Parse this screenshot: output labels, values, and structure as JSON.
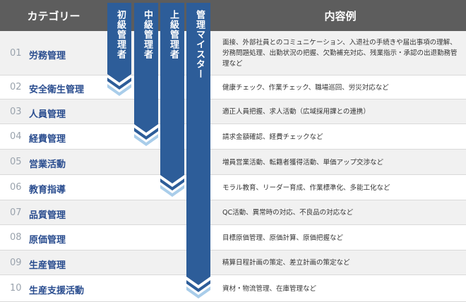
{
  "header": {
    "category": "カテゴリー",
    "content": "内容例"
  },
  "levels": [
    {
      "label": "初級管理者",
      "reach_rows": 2
    },
    {
      "label": "中級管理者",
      "reach_rows": 4
    },
    {
      "label": "上級管理者",
      "reach_rows": 6
    },
    {
      "label": "管理マイスター",
      "reach_rows": 10
    }
  ],
  "rows": [
    {
      "num": "01",
      "category": "労務管理",
      "content": "面接、外部社員とのコミュニケーション、入退社の手続きや届出事項の理解、労務問題処理、出勤状況の把握、欠勤補充対応、残業指示・承認の出退勤務管理など"
    },
    {
      "num": "02",
      "category": "安全衛生管理",
      "content": "健康チェック、作業チェック、職場巡回、労災対応など"
    },
    {
      "num": "03",
      "category": "人員管理",
      "content": "適正人員把握、求人活動（広域採用課との連携）"
    },
    {
      "num": "04",
      "category": "経費管理",
      "content": "請求金額確認、経費チェックなど"
    },
    {
      "num": "05",
      "category": "営業活動",
      "content": "増員営業活動、転籍者獲得活動、単価アップ交渉など"
    },
    {
      "num": "06",
      "category": "教育指導",
      "content": "モラル教育、リーダー育成、作業標準化、多能工化など"
    },
    {
      "num": "07",
      "category": "品質管理",
      "content": "QC活動、異常時の対応、不良品の対応など"
    },
    {
      "num": "08",
      "category": "原価管理",
      "content": "目標原価管理、原価計算、原価把握など"
    },
    {
      "num": "09",
      "category": "生産管理",
      "content": "精算日程計画の策定、差立計画の策定など"
    },
    {
      "num": "10",
      "category": "生産支援活動",
      "content": "資材・物流管理、在庫管理など"
    }
  ],
  "colors": {
    "header_bg": "#5d5d5d",
    "bar_dark": "#2d5d99",
    "bar_light": "#a9cdea",
    "category_text": "#2a4d8f"
  }
}
